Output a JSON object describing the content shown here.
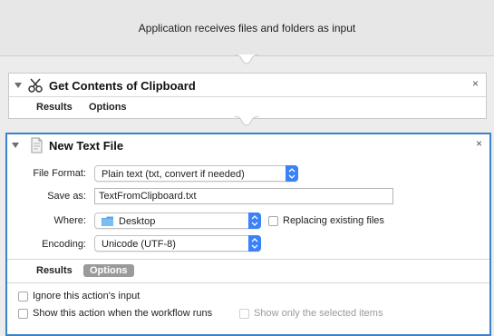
{
  "header": {
    "title": "Application receives files and folders as input"
  },
  "action1": {
    "title": "Get Contents of Clipboard",
    "icon": "scissors-icon",
    "close": "×",
    "tabs": [
      "Results",
      "Options"
    ]
  },
  "action2": {
    "title": "New Text File",
    "icon": "text-file-icon",
    "close": "×",
    "fields": {
      "file_format_label": "File Format:",
      "file_format_value": "Plain text (txt, convert if needed)",
      "save_as_label": "Save as:",
      "save_as_value": "TextFromClipboard.txt",
      "where_label": "Where:",
      "where_value": "Desktop",
      "replacing_label": "Replacing existing files",
      "encoding_label": "Encoding:",
      "encoding_value": "Unicode (UTF-8)"
    },
    "tabs": [
      "Results",
      "Options"
    ],
    "active_tab": "Options",
    "options": {
      "ignore_input": "Ignore this action's input",
      "show_when_runs": "Show this action when the workflow runs",
      "show_selected_only": "Show only the selected items"
    }
  },
  "colors": {
    "accent": "#3b82cc",
    "stepper": "#3b82f6",
    "folder": "#5aa9e6"
  }
}
